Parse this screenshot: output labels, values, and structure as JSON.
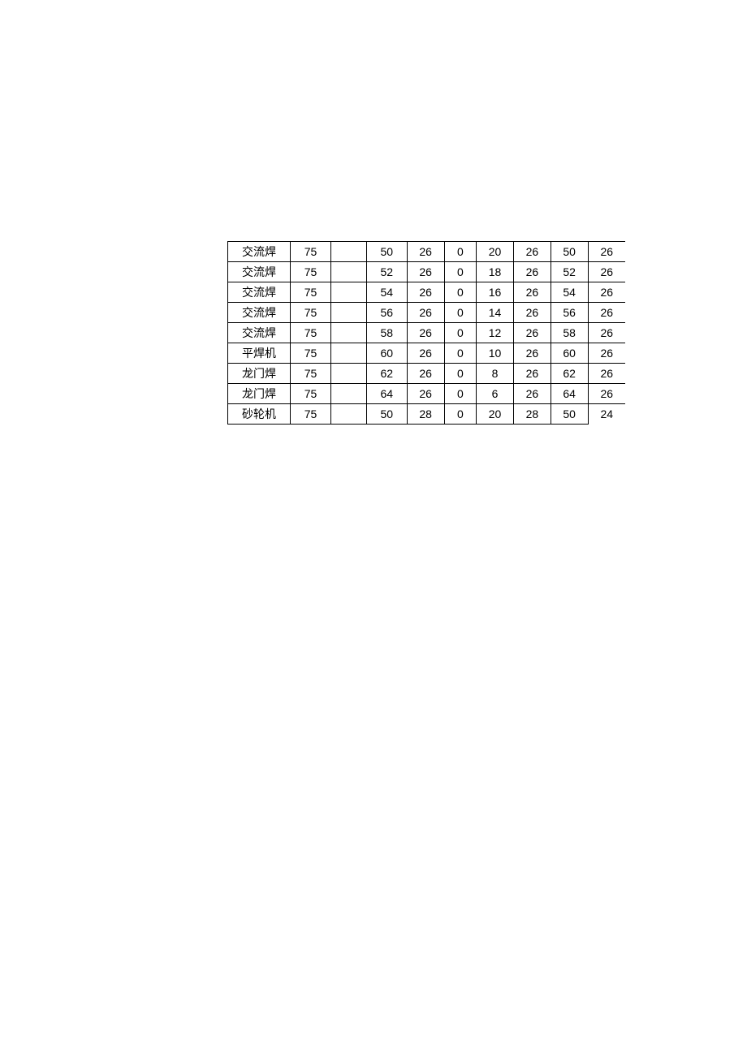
{
  "table": {
    "rows": [
      {
        "label": "交流焊",
        "c2": "75",
        "c3": "",
        "c4": "50",
        "c5": "26",
        "c6": "0",
        "c7": "20",
        "c8": "26",
        "c9": "50",
        "c10": "26"
      },
      {
        "label": "交流焊",
        "c2": "75",
        "c3": "",
        "c4": "52",
        "c5": "26",
        "c6": "0",
        "c7": "18",
        "c8": "26",
        "c9": "52",
        "c10": "26"
      },
      {
        "label": "交流焊",
        "c2": "75",
        "c3": "",
        "c4": "54",
        "c5": "26",
        "c6": "0",
        "c7": "16",
        "c8": "26",
        "c9": "54",
        "c10": "26"
      },
      {
        "label": "交流焊",
        "c2": "75",
        "c3": "",
        "c4": "56",
        "c5": "26",
        "c6": "0",
        "c7": "14",
        "c8": "26",
        "c9": "56",
        "c10": "26"
      },
      {
        "label": "交流焊",
        "c2": "75",
        "c3": "",
        "c4": "58",
        "c5": "26",
        "c6": "0",
        "c7": "12",
        "c8": "26",
        "c9": "58",
        "c10": "26"
      },
      {
        "label": "平焊机",
        "c2": "75",
        "c3": "",
        "c4": "60",
        "c5": "26",
        "c6": "0",
        "c7": "10",
        "c8": "26",
        "c9": "60",
        "c10": "26"
      },
      {
        "label": "龙门焊",
        "c2": "75",
        "c3": "",
        "c4": "62",
        "c5": "26",
        "c6": "0",
        "c7": "8",
        "c8": "26",
        "c9": "62",
        "c10": "26"
      },
      {
        "label": "龙门焊",
        "c2": "75",
        "c3": "",
        "c4": "64",
        "c5": "26",
        "c6": "0",
        "c7": "6",
        "c8": "26",
        "c9": "64",
        "c10": "26"
      },
      {
        "label": "砂轮机",
        "c2": "75",
        "c3": "",
        "c4": "50",
        "c5": "28",
        "c6": "0",
        "c7": "20",
        "c8": "28",
        "c9": "50",
        "c10": "24"
      }
    ]
  }
}
